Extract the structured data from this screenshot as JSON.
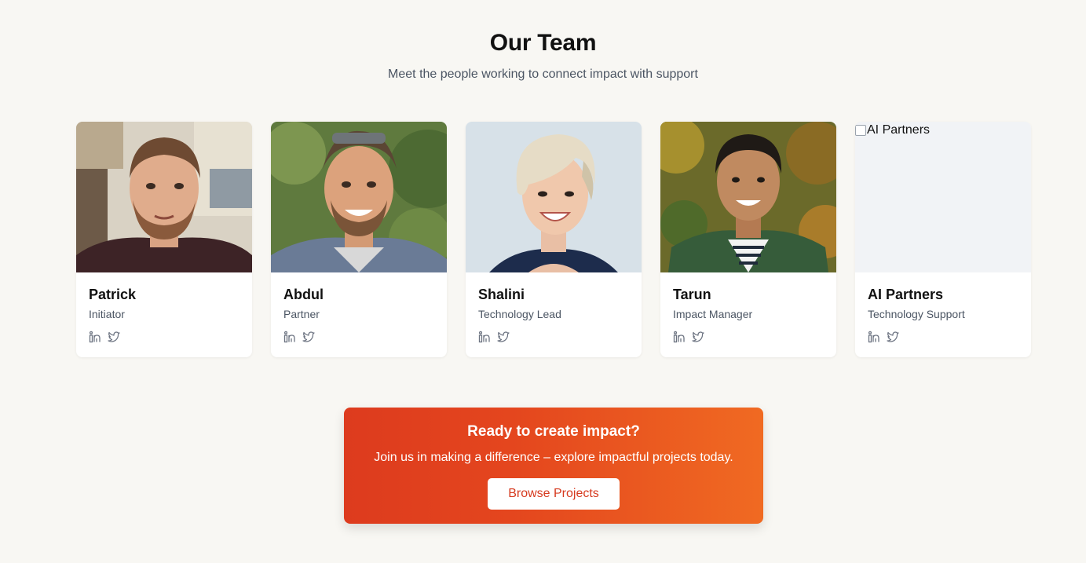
{
  "header": {
    "title": "Our Team",
    "subtitle": "Meet the people working to connect impact with support"
  },
  "team": [
    {
      "name": "Patrick",
      "role": "Initiator",
      "photo": "photo"
    },
    {
      "name": "Abdul",
      "role": "Partner",
      "photo": "photo"
    },
    {
      "name": "Shalini",
      "role": "Technology Lead",
      "photo": "photo"
    },
    {
      "name": "Tarun",
      "role": "Impact Manager",
      "photo": "photo"
    },
    {
      "name": "AI Partners",
      "role": "Technology Support",
      "photo": "broken",
      "photo_alt": "AI Partners"
    }
  ],
  "social_icons": [
    "linkedin-icon",
    "twitter-icon"
  ],
  "cta": {
    "title": "Ready to create impact?",
    "text": "Join us in making a difference – explore impactful projects today.",
    "button_label": "Browse Projects"
  },
  "colors": {
    "background": "#f8f7f3",
    "cta_gradient_start": "#dd3b1e",
    "cta_gradient_end": "#f06a22",
    "button_text": "#d63a1f",
    "icon_gray": "#6b7280"
  }
}
